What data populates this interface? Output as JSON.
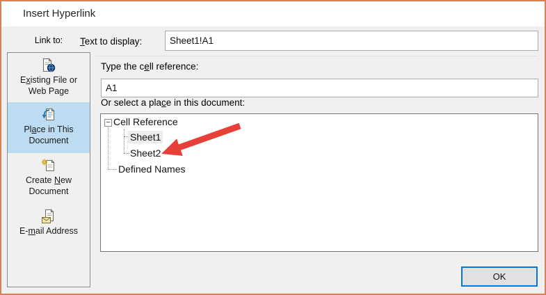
{
  "window": {
    "title": "Insert Hyperlink"
  },
  "colors": {
    "window_border": "#DC8052",
    "selected_category_bg": "#BDDBF1",
    "ok_button_border": "#0078D7",
    "annotation_arrow": "#E74038"
  },
  "sidebar": {
    "heading": "Link to:",
    "selected_index": 1,
    "items": [
      {
        "icon": "existing-file-web-page-icon",
        "line1_pre": "E",
        "line1_key": "x",
        "line1_post": "isting File or",
        "line2": "Web Page"
      },
      {
        "icon": "place-in-this-document-icon",
        "line1_pre": "Pl",
        "line1_key": "a",
        "line1_post": "ce in This",
        "line2": "Document"
      },
      {
        "icon": "create-new-document-icon",
        "line1_pre": "Create ",
        "line1_key": "N",
        "line1_post": "ew",
        "line2": "Document"
      },
      {
        "icon": "email-address-icon",
        "line1_pre": "E-",
        "line1_key": "m",
        "line1_post": "ail Address",
        "line2": ""
      }
    ]
  },
  "fields": {
    "text_to_display": {
      "label_pre": "",
      "label_key": "T",
      "label_post": "ext to display:",
      "value": "Sheet1!A1"
    },
    "cell_reference": {
      "label_pre": "Type the c",
      "label_key": "e",
      "label_post": "ll reference:",
      "value": "A1"
    },
    "select_place": {
      "label_pre": "Or select a pla",
      "label_key": "c",
      "label_post": "e in this document:"
    }
  },
  "tree": {
    "collapse_glyph": "−",
    "root": "Cell Reference",
    "children": [
      "Sheet1",
      "Sheet2"
    ],
    "sibling": "Defined Names"
  },
  "buttons": {
    "ok": "OK"
  },
  "annotation": {
    "arrow_color": "#E74038"
  }
}
